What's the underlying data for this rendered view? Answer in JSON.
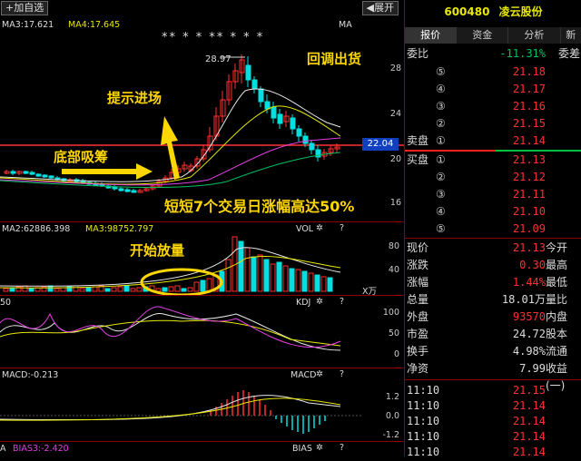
{
  "toolbar": {
    "add_label": "+加自选",
    "expand_label": "◀展开"
  },
  "main_chart": {
    "ma3": "MA3:17.621",
    "ma4": "MA4:17.645",
    "ma_right": "MA",
    "stars": "**  *  *  ** * *   *",
    "high_label": "28.97",
    "current_price": "22.04",
    "price_ticks": [
      "28",
      "24",
      "20",
      "16"
    ],
    "annotations": {
      "bottom_accumulate": "底部吸筹",
      "signal_entry": "提示进场",
      "pullback_sell": "回调出货",
      "headline": "短短7个交易日涨幅高达50%",
      "volume_surge": "开始放量"
    }
  },
  "volume_panel": {
    "ma2": "MA2:62886.398",
    "ma3": "MA3:98752.797",
    "vol_label": "VOL",
    "ticks": [
      "80",
      "40"
    ],
    "unit": "X万"
  },
  "kdj_panel": {
    "left_val": "50",
    "label": "KDJ",
    "ticks": [
      "100",
      "50",
      "0"
    ]
  },
  "macd_panel": {
    "value": "MACD:-0.213",
    "label": "MACD",
    "ticks": [
      "1.2",
      "0.0",
      "-1.2"
    ]
  },
  "bias_panel": {
    "prefix": "A",
    "value": "BIAS3:-2.420",
    "label": "BIAS"
  },
  "quote": {
    "code": "600480",
    "name": "凌云股份",
    "tabs": [
      "报价",
      "资金",
      "分析",
      "新"
    ],
    "webi_label": "委比",
    "webi_value": "-11.31%",
    "wecha_label": "委差",
    "sell_label": "卖盘",
    "buy_label": "买盘",
    "sell_levels": [
      {
        "n": "⑤",
        "price": "21.18"
      },
      {
        "n": "④",
        "price": "21.17"
      },
      {
        "n": "③",
        "price": "21.16"
      },
      {
        "n": "②",
        "price": "21.15"
      },
      {
        "n": "①",
        "price": "21.14"
      }
    ],
    "buy_levels": [
      {
        "n": "①",
        "price": "21.13"
      },
      {
        "n": "②",
        "price": "21.12"
      },
      {
        "n": "③",
        "price": "21.11"
      },
      {
        "n": "④",
        "price": "21.10"
      },
      {
        "n": "⑤",
        "price": "21.09"
      }
    ],
    "stats": [
      {
        "k": "现价",
        "v": "21.13",
        "k2": "今开",
        "color": "#ff3030"
      },
      {
        "k": "涨跌",
        "v": "0.30",
        "k2": "最高",
        "color": "#ff3030"
      },
      {
        "k": "涨幅",
        "v": "1.44%",
        "k2": "最低",
        "color": "#ff3030"
      },
      {
        "k": "总量",
        "v": "18.01万",
        "k2": "量比",
        "color": "#ddd"
      },
      {
        "k": "外盘",
        "v": "93570",
        "k2": "内盘",
        "color": "#ff3030"
      },
      {
        "k": "市盈",
        "v": "24.72",
        "k2": "股本",
        "color": "#ddd"
      },
      {
        "k": "换手",
        "v": "4.98%",
        "k2": "流通",
        "color": "#ddd"
      },
      {
        "k": "净资",
        "v": "7.99",
        "k2": "收益(一)",
        "color": "#ddd"
      }
    ],
    "ticks": [
      {
        "time": "11:10",
        "price": "21.15"
      },
      {
        "time": "11:10",
        "price": "21.14"
      },
      {
        "time": "11:10",
        "price": "21.14"
      },
      {
        "time": "11:10",
        "price": "21.14"
      },
      {
        "time": "11:10",
        "price": "21.14"
      }
    ]
  }
}
